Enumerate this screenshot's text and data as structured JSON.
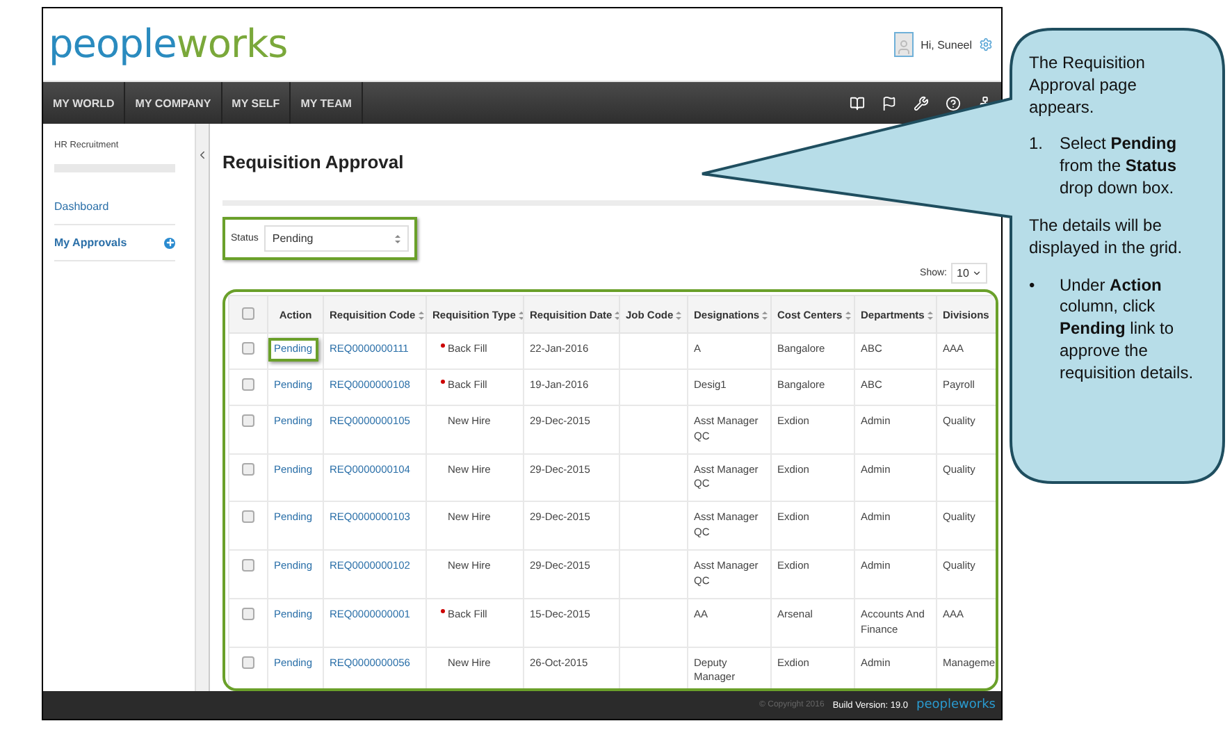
{
  "header": {
    "logo": {
      "first": "people",
      "second": "works"
    },
    "greeting": "Hi, Suneel"
  },
  "nav": {
    "items": [
      {
        "label": "MY WORLD",
        "selected": false
      },
      {
        "label": "MY COMPANY",
        "selected": false
      },
      {
        "label": "MY SELF",
        "selected": false
      },
      {
        "label": "MY TEAM",
        "selected": false
      }
    ]
  },
  "sidebar": {
    "title": "HR Recruitment",
    "items": [
      {
        "label": "Dashboard",
        "selected": false
      },
      {
        "label": "My Approvals",
        "selected": true
      }
    ]
  },
  "page": {
    "title": "Requisition Approval",
    "status": {
      "label": "Status",
      "value": "Pending",
      "highlighted": true
    },
    "show": {
      "label": "Show:",
      "value": "10"
    }
  },
  "table": {
    "highlighted": true,
    "header_checkbox": {
      "checked": false
    },
    "columns": [
      "Action",
      "Requisition Code",
      "Requisition Type",
      "Requisition Date",
      "Job Code",
      "Designations",
      "Cost Centers",
      "Departments",
      "Divisions"
    ],
    "rows": [
      {
        "checked": false,
        "action": "Pending",
        "action_highlighted": true,
        "code": "REQ0000000111",
        "type": "Back Fill",
        "flagged": true,
        "date": "22-Jan-2016",
        "job_code": "",
        "designation": "A",
        "cost_center": "Bangalore",
        "department": "ABC",
        "division": "AAA"
      },
      {
        "checked": false,
        "action": "Pending",
        "action_highlighted": false,
        "code": "REQ0000000108",
        "type": "Back Fill",
        "flagged": true,
        "date": "19-Jan-2016",
        "job_code": "",
        "designation": "Desig1",
        "cost_center": "Bangalore",
        "department": "ABC",
        "division": "Payroll"
      },
      {
        "checked": false,
        "action": "Pending",
        "action_highlighted": false,
        "code": "REQ0000000105",
        "type": "New Hire",
        "flagged": false,
        "date": "29-Dec-2015",
        "job_code": "",
        "designation": "Asst Manager QC",
        "cost_center": "Exdion",
        "department": "Admin",
        "division": "Quality"
      },
      {
        "checked": false,
        "action": "Pending",
        "action_highlighted": false,
        "code": "REQ0000000104",
        "type": "New Hire",
        "flagged": false,
        "date": "29-Dec-2015",
        "job_code": "",
        "designation": "Asst Manager QC",
        "cost_center": "Exdion",
        "department": "Admin",
        "division": "Quality"
      },
      {
        "checked": false,
        "action": "Pending",
        "action_highlighted": false,
        "code": "REQ0000000103",
        "type": "New Hire",
        "flagged": false,
        "date": "29-Dec-2015",
        "job_code": "",
        "designation": "Asst Manager QC",
        "cost_center": "Exdion",
        "department": "Admin",
        "division": "Quality"
      },
      {
        "checked": false,
        "action": "Pending",
        "action_highlighted": false,
        "code": "REQ0000000102",
        "type": "New Hire",
        "flagged": false,
        "date": "29-Dec-2015",
        "job_code": "",
        "designation": "Asst Manager QC",
        "cost_center": "Exdion",
        "department": "Admin",
        "division": "Quality"
      },
      {
        "checked": false,
        "action": "Pending",
        "action_highlighted": false,
        "code": "REQ0000000001",
        "type": "Back Fill",
        "flagged": true,
        "date": "15-Dec-2015",
        "job_code": "",
        "designation": "AA",
        "cost_center": "Arsenal",
        "department": "Accounts And Finance",
        "division": "AAA"
      },
      {
        "checked": false,
        "action": "Pending",
        "action_highlighted": false,
        "code": "REQ0000000056",
        "type": "New Hire",
        "flagged": false,
        "date": "26-Oct-2015",
        "job_code": "",
        "designation": "Deputy Manager",
        "cost_center": "Exdion",
        "department": "Admin",
        "division": "Manageme"
      }
    ]
  },
  "footer": {
    "copyright": "© Copyright 2016",
    "build": "Build Version: 19.0",
    "logo": "peopleworks"
  },
  "callout": {
    "blocks": [
      {
        "kind": "text",
        "text": "The Requisition Approval page appears."
      },
      {
        "kind": "item",
        "marker": "1.",
        "text": "Select **Pending** from the **Status** drop down box."
      },
      {
        "kind": "text",
        "text": "The details will be displayed in the grid."
      },
      {
        "kind": "item",
        "marker": "•",
        "text": "Under **Action** column, click **Pending** link to approve the requisition details."
      }
    ]
  }
}
